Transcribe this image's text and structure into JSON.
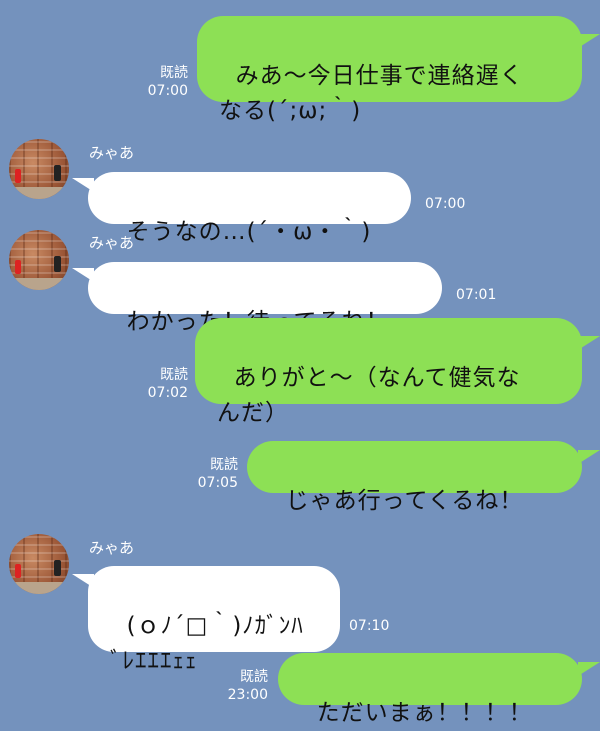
{
  "messages": [
    {
      "type": "out",
      "text": "みあ〜今日仕事で連絡遅く\nなる(´;ω;｀)",
      "read": "既読",
      "time": "07:00"
    },
    {
      "type": "in",
      "sender": "みゃあ",
      "text": "そうなの…(´・ω・｀)",
      "time": "07:00"
    },
    {
      "type": "in",
      "sender": "みゃあ",
      "text": "わかった！待ってるね！",
      "time": "07:01"
    },
    {
      "type": "out",
      "text": "ありがと〜（なんて健気な\nんだ）",
      "read": "既読",
      "time": "07:02"
    },
    {
      "type": "out",
      "text": "じゃあ行ってくるね！",
      "read": "既読",
      "time": "07:05"
    },
    {
      "type": "in",
      "sender": "みゃあ",
      "text": "(ｏﾉ´□｀)ﾉｶﾞﾝﾊ\nﾞﾚｴｴｴｪｪ",
      "time": "07:10"
    },
    {
      "type": "out",
      "text": "ただいまぁ！！！！",
      "read": "既読",
      "time": "23:00"
    }
  ]
}
